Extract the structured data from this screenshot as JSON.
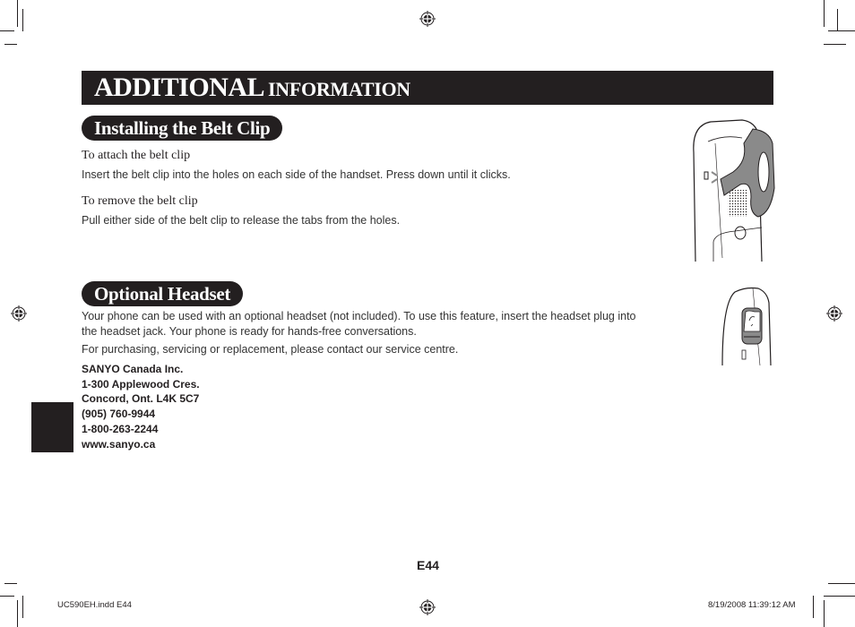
{
  "header": {
    "title_big": "ADDITIONAL",
    "title_small": "INFORMATION"
  },
  "sections": {
    "belt_clip": {
      "title": "Installing the Belt Clip",
      "attach_heading": "To attach the belt clip",
      "attach_text": "Insert the belt clip into the holes on each side of the handset. Press down until it clicks.",
      "remove_heading": "To remove the belt clip",
      "remove_text": "Pull either side of the belt clip to release the tabs from the holes.",
      "illustration": "handset-with-belt-clip"
    },
    "headset": {
      "title": "Optional Headset",
      "line1": "Your phone can be used with an optional headset (not included). To use this feature, insert the headset plug into",
      "line2": "the headset jack. Your phone is ready for hands-free conversations.",
      "line3": "For purchasing, servicing or replacement, please contact our service centre.",
      "illustration": "handset-headset-jack"
    }
  },
  "address": {
    "lines": [
      "SANYO Canada Inc.",
      "1-300 Applewood Cres.",
      "Concord, Ont. L4K 5C7",
      "(905) 760-9944",
      "1-800-263-2244",
      "www.sanyo.ca"
    ]
  },
  "page_number": "E44",
  "footer": {
    "file": "UC590EH.indd   E44",
    "timestamp": "8/19/2008   11:39:12 AM"
  },
  "colors": {
    "ink": "#231f20",
    "clip_gray": "#8a8a8a"
  }
}
